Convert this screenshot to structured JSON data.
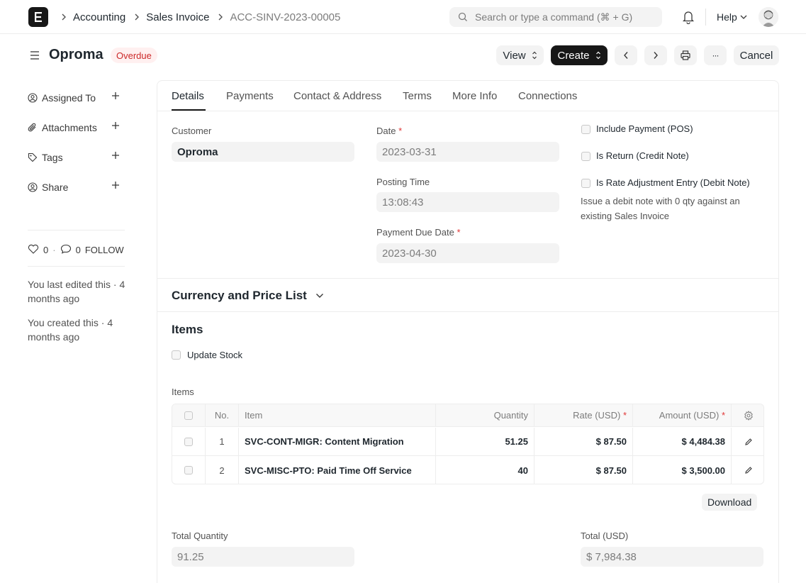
{
  "navbar": {
    "breadcrumbs": [
      "Accounting",
      "Sales Invoice",
      "ACC-SINV-2023-00005"
    ],
    "search_placeholder": "Search or type a command (⌘ + G)",
    "help_label": "Help"
  },
  "header": {
    "title": "Oproma",
    "status": "Overdue",
    "view_label": "View",
    "create_label": "Create",
    "cancel_label": "Cancel",
    "more_label": "···"
  },
  "sidebar": {
    "items": [
      {
        "label": "Assigned To",
        "icon": "assign-icon"
      },
      {
        "label": "Attachments",
        "icon": "paperclip-icon"
      },
      {
        "label": "Tags",
        "icon": "tag-icon"
      },
      {
        "label": "Share",
        "icon": "share-icon"
      }
    ],
    "likes": "0",
    "comments": "0",
    "follow": "FOLLOW",
    "last_edited": "You last edited this · 4 months ago",
    "created": "You created this · 4 months ago"
  },
  "tabs": [
    "Details",
    "Payments",
    "Contact & Address",
    "Terms",
    "More Info",
    "Connections"
  ],
  "details": {
    "customer_label": "Customer",
    "customer_value": "Oproma",
    "date_label": "Date",
    "date_value": "2023-03-31",
    "posting_time_label": "Posting Time",
    "posting_time_value": "13:08:43",
    "due_date_label": "Payment Due Date",
    "due_date_value": "2023-04-30",
    "required_mark": "*",
    "include_payment_label": "Include Payment (POS)",
    "is_return_label": "Is Return (Credit Note)",
    "rate_adjust_label": "Is Rate Adjustment Entry (Debit Note)",
    "rate_adjust_desc": "Issue a debit note with 0 qty against an existing Sales Invoice"
  },
  "currency_section": {
    "title": "Currency and Price List"
  },
  "items_section": {
    "title": "Items",
    "update_stock_label": "Update Stock",
    "table_label": "Items",
    "columns": {
      "no": "No.",
      "item": "Item",
      "quantity": "Quantity",
      "rate": "Rate (USD)",
      "amount": "Amount (USD)"
    },
    "rows": [
      {
        "no": "1",
        "item": "SVC-CONT-MIGR: Content Migration",
        "quantity": "51.25",
        "rate": "$ 87.50",
        "amount": "$ 4,484.38"
      },
      {
        "no": "2",
        "item": "SVC-MISC-PTO: Paid Time Off Service",
        "quantity": "40",
        "rate": "$ 87.50",
        "amount": "$ 3,500.00"
      }
    ],
    "download_label": "Download",
    "total_quantity_label": "Total Quantity",
    "total_quantity_value": "91.25",
    "total_label": "Total (USD)",
    "total_value": "$ 7,984.38"
  }
}
